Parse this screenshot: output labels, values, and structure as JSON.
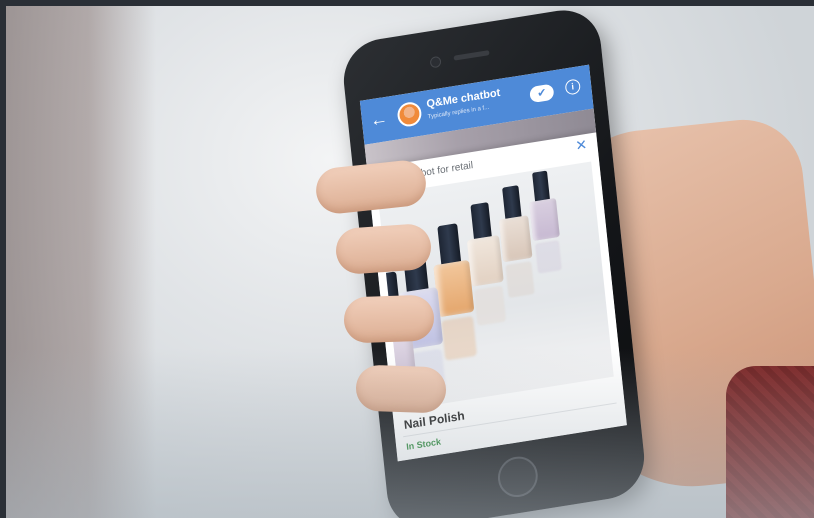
{
  "chat_header": {
    "bot_name": "Q&Me chatbot",
    "bot_status": "Typically replies in a f...",
    "back_icon": "arrow-left-icon",
    "toggle_icon": "check-icon",
    "info_icon": "info-icon",
    "accent_color": "#4e8ad8"
  },
  "card": {
    "title": "Chatbot for retail",
    "close_icon": "close-icon",
    "product": {
      "name": "Nail Polish",
      "status": "In Stock",
      "status_color": "#2e8b3c"
    }
  },
  "glyphs": {
    "back": "←",
    "check": "✔",
    "info": "i",
    "close": "✕"
  }
}
